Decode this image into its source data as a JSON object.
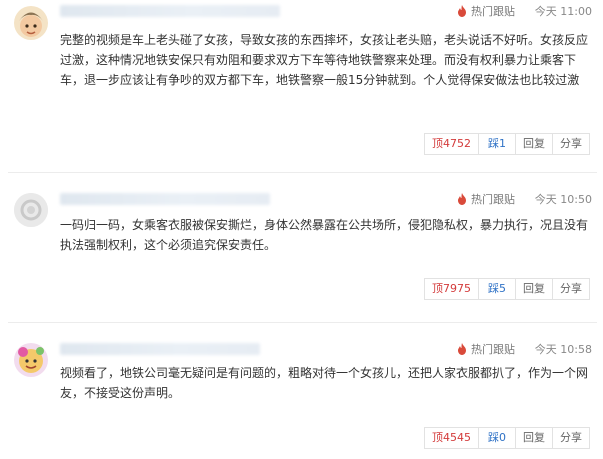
{
  "comments": [
    {
      "hot_label": "热门跟贴",
      "time": "今天 11:00",
      "text": "完整的视频是车上老头碰了女孩，导致女孩的东西摔坏，女孩让老头赔，老头说话不好听。女孩反应过激，这种情况地铁安保只有劝阻和要求双方下车等待地铁警察来处理。而没有权利暴力让乘客下车，退一步应该让有争吵的双方都下车，地铁警察一般15分钟就到。个人觉得保安做法也比较过激",
      "up": "顶4752",
      "down": "踩1",
      "reply": "回复",
      "share": "分享"
    },
    {
      "hot_label": "热门跟贴",
      "time": "今天 10:50",
      "text": "一码归一码，女乘客衣服被保安撕烂，身体公然暴露在公共场所，侵犯隐私权，暴力执行，况且没有执法强制权利，这个必须追究保安责任。",
      "up": "顶7975",
      "down": "踩5",
      "reply": "回复",
      "share": "分享"
    },
    {
      "hot_label": "热门跟贴",
      "time": "今天 10:58",
      "text": "视频看了，地铁公司毫无疑问是有问题的，粗略对待一个女孩儿，还把人家衣服都扒了，作为一个网友，不接受这份声明。",
      "up": "顶4545",
      "down": "踩0",
      "reply": "回复",
      "share": "分享"
    }
  ]
}
